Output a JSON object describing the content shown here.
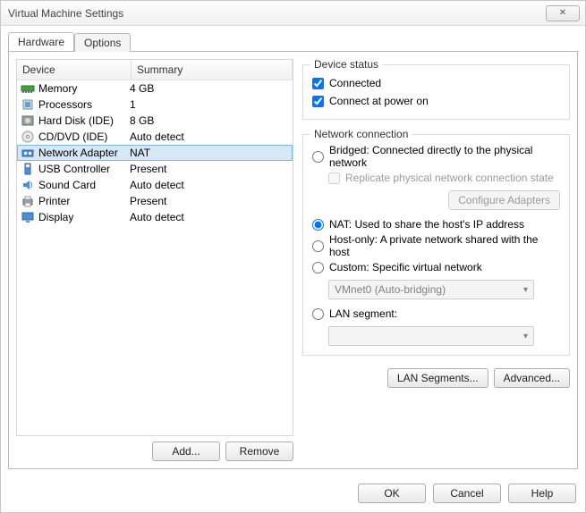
{
  "window": {
    "title": "Virtual Machine Settings",
    "close_glyph": "✕"
  },
  "tabs": {
    "hardware": "Hardware",
    "options": "Options"
  },
  "columns": {
    "device": "Device",
    "summary": "Summary"
  },
  "devices": [
    {
      "name": "Memory",
      "summary": "4 GB",
      "icon": "memory"
    },
    {
      "name": "Processors",
      "summary": "1",
      "icon": "cpu"
    },
    {
      "name": "Hard Disk (IDE)",
      "summary": "8 GB",
      "icon": "disk"
    },
    {
      "name": "CD/DVD (IDE)",
      "summary": "Auto detect",
      "icon": "cd"
    },
    {
      "name": "Network Adapter",
      "summary": "NAT",
      "icon": "net",
      "selected": true
    },
    {
      "name": "USB Controller",
      "summary": "Present",
      "icon": "usb"
    },
    {
      "name": "Sound Card",
      "summary": "Auto detect",
      "icon": "sound"
    },
    {
      "name": "Printer",
      "summary": "Present",
      "icon": "printer"
    },
    {
      "name": "Display",
      "summary": "Auto detect",
      "icon": "display"
    }
  ],
  "left_buttons": {
    "add": "Add...",
    "remove": "Remove"
  },
  "device_status": {
    "title": "Device status",
    "connected": "Connected",
    "connect_power": "Connect at power on"
  },
  "net_conn": {
    "title": "Network connection",
    "bridged": "Bridged: Connected directly to the physical network",
    "replicate": "Replicate physical network connection state",
    "configure_adapters": "Configure Adapters",
    "nat": "NAT: Used to share the host's IP address",
    "hostonly": "Host-only: A private network shared with the host",
    "custom": "Custom: Specific virtual network",
    "custom_value": "VMnet0 (Auto-bridging)",
    "lan_segment": "LAN segment:",
    "lan_value": ""
  },
  "right_buttons": {
    "lan_segments": "LAN Segments...",
    "advanced": "Advanced..."
  },
  "footer": {
    "ok": "OK",
    "cancel": "Cancel",
    "help": "Help"
  }
}
